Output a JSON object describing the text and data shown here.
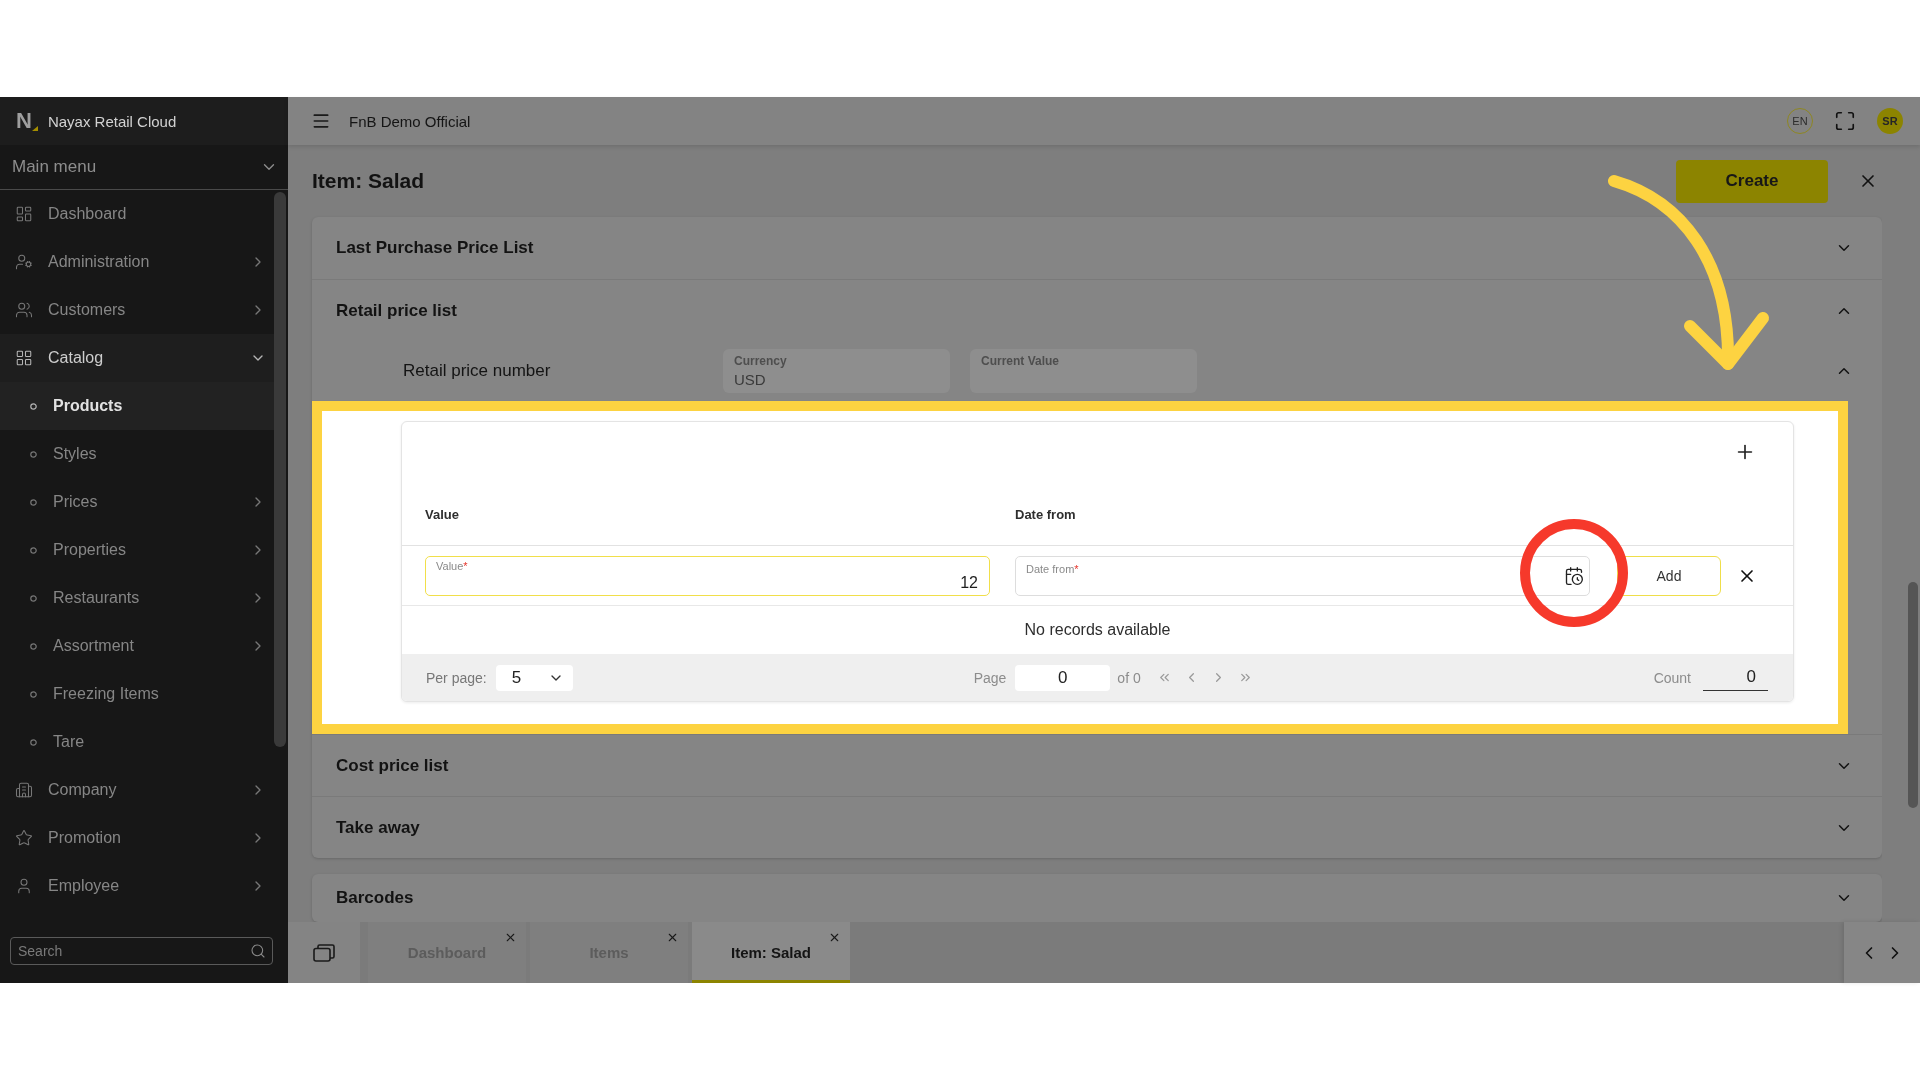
{
  "sidebar": {
    "logo": "N",
    "brand": "Nayax Retail Cloud",
    "menu_title": "Main menu",
    "items": [
      {
        "label": "Dashboard",
        "selected": false
      },
      {
        "label": "Administration",
        "expanded": false,
        "selected": false
      },
      {
        "label": "Customers",
        "expanded": false,
        "selected": false
      },
      {
        "label": "Catalog",
        "expanded": true,
        "selected": false,
        "children": [
          {
            "label": "Products",
            "selected": true
          },
          {
            "label": "Styles",
            "selected": false
          },
          {
            "label": "Prices",
            "expanded": false,
            "selected": false
          },
          {
            "label": "Properties",
            "expanded": false,
            "selected": false
          },
          {
            "label": "Restaurants",
            "expanded": false,
            "selected": false
          },
          {
            "label": "Assortment",
            "expanded": false,
            "selected": false
          },
          {
            "label": "Freezing Items",
            "selected": false
          },
          {
            "label": "Tare",
            "selected": false
          }
        ]
      },
      {
        "label": "Company",
        "expanded": false,
        "selected": false
      },
      {
        "label": "Promotion",
        "expanded": false,
        "selected": false
      },
      {
        "label": "Employee",
        "expanded": false,
        "selected": false
      }
    ],
    "search": {
      "placeholder": "Search"
    }
  },
  "top_bar": {
    "workspace": "FnB Demo Official",
    "language": "EN",
    "user_initials": "SR"
  },
  "page": {
    "title": "Item: Salad",
    "create_button": "Create"
  },
  "cards": [
    {
      "sections": [
        {
          "title": "Last Purchase Price List",
          "expanded": false
        },
        {
          "title": "Retail price list",
          "expanded": true,
          "subsections": [
            {
              "title": "Retail price number",
              "expanded": true,
              "fields": [
                {
                  "label": "Currency",
                  "value": "USD"
                },
                {
                  "label": "Current Value"
                }
              ],
              "table": {
                "highlighted": true,
                "columns": [
                  "Value",
                  "Date from"
                ],
                "new_row": {
                  "fields": [
                    {
                      "kind": "number",
                      "label": "Value",
                      "required_mark": "*",
                      "value": "12",
                      "focused": true
                    },
                    {
                      "kind": "date",
                      "label": "Date from",
                      "required_mark": "*",
                      "focused": false,
                      "highlighted": true
                    }
                  ],
                  "add_button": "Add"
                },
                "empty_message": "No records available",
                "pager": {
                  "per_page_label": "Per page:",
                  "per_page": "5",
                  "page_label": "Page",
                  "page": "0",
                  "page_total": "of 0",
                  "count_label": "Count",
                  "count": "0"
                }
              }
            }
          ]
        },
        {
          "title": "Cost price list",
          "expanded": false
        },
        {
          "title": "Take away",
          "expanded": false
        }
      ]
    },
    {
      "sections": [
        {
          "title": "Barcodes",
          "expanded": false
        }
      ]
    }
  ],
  "tabs": [
    {
      "label": "Dashboard",
      "selected": false
    },
    {
      "label": "Items",
      "selected": false
    },
    {
      "label": "Item: Salad",
      "selected": true
    }
  ]
}
